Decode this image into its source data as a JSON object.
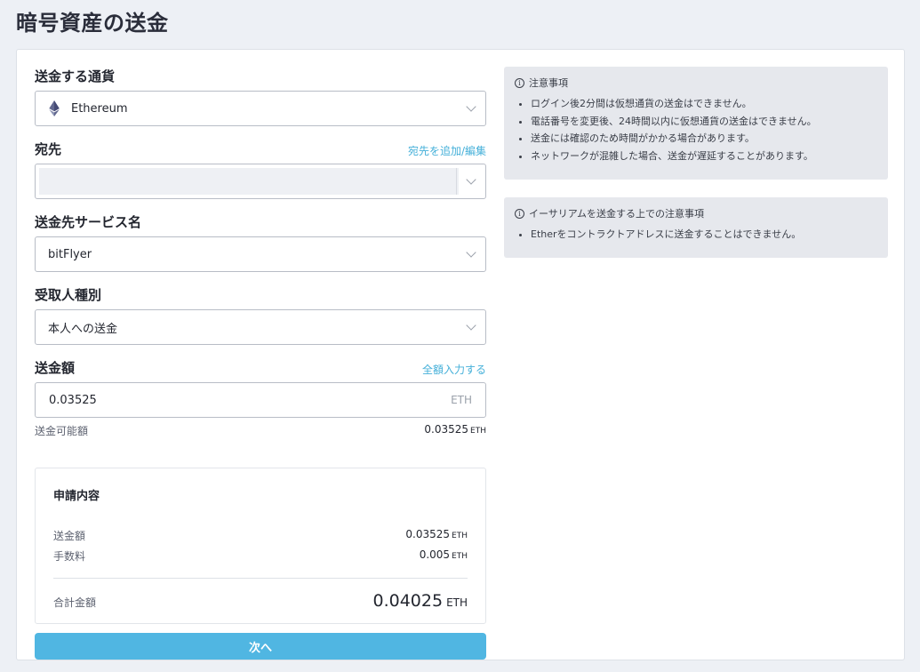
{
  "page": {
    "title": "暗号資産の送金"
  },
  "currency": {
    "label": "送金する通貨",
    "value": "Ethereum"
  },
  "destination": {
    "label": "宛先",
    "link": "宛先を追加/編集",
    "value": ""
  },
  "service": {
    "label": "送金先サービス名",
    "value": "bitFlyer"
  },
  "recipient": {
    "label": "受取人種別",
    "value": "本人への送金"
  },
  "amount": {
    "label": "送金額",
    "link": "全額入力する",
    "value": "0.03525",
    "unit": "ETH",
    "available_label": "送金可能額",
    "available_value": "0.03525",
    "available_unit": "ETH"
  },
  "summary": {
    "title": "申請内容",
    "amount_label": "送金額",
    "amount_value": "0.03525",
    "amount_unit": "ETH",
    "fee_label": "手数料",
    "fee_value": "0.005",
    "fee_unit": "ETH",
    "total_label": "合計金額",
    "total_value": "0.04025",
    "total_unit": "ETH"
  },
  "next_button": {
    "label": "次へ"
  },
  "notice1": {
    "title": "注意事項",
    "items": [
      "ログイン後2分間は仮想通貨の送金はできません。",
      "電話番号を変更後、24時間以内に仮想通貨の送金はできません。",
      "送金には確認のため時間がかかる場合があります。",
      "ネットワークが混雑した場合、送金が遅延することがあります。"
    ]
  },
  "notice2": {
    "title": "イーサリアムを送金する上での注意事項",
    "items": [
      "Etherをコントラクトアドレスに送金することはできません。"
    ]
  },
  "icons": {
    "currency": "ethereum-icon",
    "dropdown": "chevron-down-icon",
    "info": "info-icon"
  }
}
